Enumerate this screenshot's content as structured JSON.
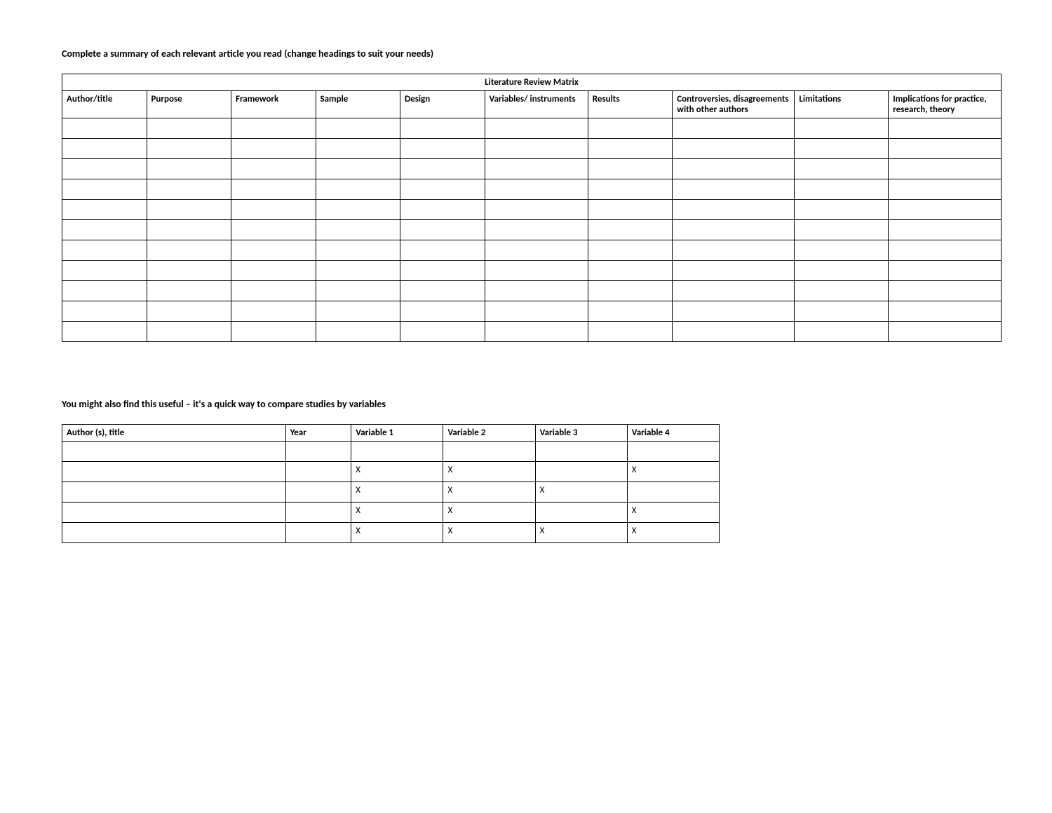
{
  "intro1": "Complete a summary of each relevant article you read (change headings to suit your needs)",
  "matrix": {
    "caption": "Literature Review Matrix",
    "headers": {
      "author": "Author/title",
      "purpose": "Purpose",
      "framework": "Framework",
      "sample": "Sample",
      "design": "Design",
      "variables": "Variables/ instruments",
      "results": "Results",
      "controversies": "Controversies, disagreements with other authors",
      "limitations": "Limitations",
      "implications": "Implications for practice, research, theory"
    },
    "rows": 11
  },
  "intro2": "You might also find this useful – it's a quick way to compare studies by variables",
  "vars": {
    "headers": {
      "author": "Author (s), title",
      "year": "Year",
      "v1": "Variable 1",
      "v2": "Variable 2",
      "v3": "Variable 3",
      "v4": "Variable 4"
    },
    "rows": [
      {
        "author": "",
        "year": "",
        "v1": "",
        "v2": "",
        "v3": "",
        "v4": ""
      },
      {
        "author": "",
        "year": "",
        "v1": "X",
        "v2": "X",
        "v3": "",
        "v4": "X"
      },
      {
        "author": "",
        "year": "",
        "v1": "X",
        "v2": "X",
        "v3": "X",
        "v4": ""
      },
      {
        "author": "",
        "year": "",
        "v1": "X",
        "v2": "X",
        "v3": "",
        "v4": "X"
      },
      {
        "author": "",
        "year": "",
        "v1": "X",
        "v2": "X",
        "v3": "X",
        "v4": "X"
      }
    ]
  }
}
